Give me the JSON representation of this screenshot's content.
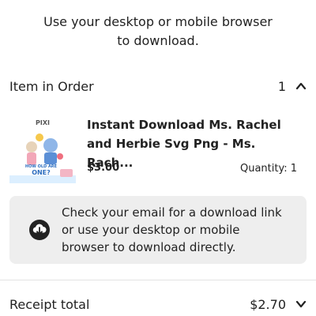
{
  "intro": {
    "line1": "Use your desktop or mobile browser",
    "line2": "to download."
  },
  "order": {
    "header_label": "Item in Order",
    "count": "1",
    "toggle_icon": "chevron-up-icon"
  },
  "item": {
    "thumbnail": {
      "brand_text": "PIXI",
      "tagline_line1": "HOW OLD ARE",
      "tagline_line2": "ONE?"
    },
    "title_line1": "Instant Download Ms. Rachel",
    "title_line2": "and Herbie Svg Png - Ms. Rach...",
    "price": "$3.00",
    "quantity": "Quantity: 1"
  },
  "notice": {
    "icon": "cloud-download-icon",
    "line1": "Check your email for a download link",
    "line2": "or use your desktop or mobile",
    "line3": "browser to download directly."
  },
  "receipt": {
    "label": "Receipt total",
    "amount": "$2.70",
    "toggle_icon": "chevron-down-icon"
  },
  "colors": {
    "text": "#222222",
    "notice_bg": "#eeeeee",
    "divider": "#e3e3e3"
  }
}
